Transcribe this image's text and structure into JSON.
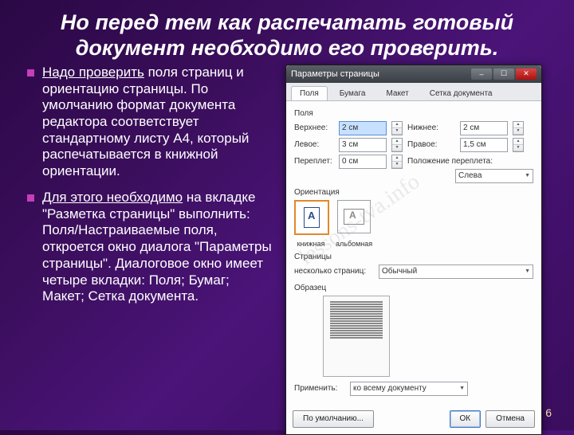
{
  "title": "Но перед тем как распечатать готовый документ необходимо его проверить.",
  "bullets": [
    {
      "lead": "Надо проверить",
      "rest": " поля страниц и ориентацию страницы. По умолчанию формат документа редактора соответствует стандартному листу А4, который распечатывается в книжной ориентации."
    },
    {
      "lead": "Для этого необходимо",
      "rest": " на вкладке \"Разметка страницы\" выполнить: Поля/Настраиваемые поля, откроется окно диалога \"Параметры страницы\". Диалоговое окно имеет четыре вкладки: Поля; Бумаг; Макет; Сетка документа."
    }
  ],
  "dialog": {
    "title": "Параметры страницы",
    "tabs": [
      "Поля",
      "Бумага",
      "Макет",
      "Сетка документа"
    ],
    "fields_section": "Поля",
    "fields": {
      "top_label": "Верхнее:",
      "top_value": "2 см",
      "bottom_label": "Нижнее:",
      "bottom_value": "2 см",
      "left_label": "Левое:",
      "left_value": "3 см",
      "right_label": "Правое:",
      "right_value": "1,5 см",
      "gutter_label": "Переплет:",
      "gutter_value": "0 см",
      "gutter_pos_label": "Положение переплета:",
      "gutter_pos_value": "Слева"
    },
    "orientation_label": "Ориентация",
    "orient": {
      "portrait": "книжная",
      "landscape": "альбомная"
    },
    "pages_label": "Страницы",
    "pages_row_label": "несколько страниц:",
    "pages_value": "Обычный",
    "sample_label": "Образец",
    "apply_label": "Применить:",
    "apply_value": "ко всему документу",
    "btn_default": "По умолчанию...",
    "btn_ok": "ОК",
    "btn_cancel": "Отмена"
  },
  "watermark": "lessons-tva.info",
  "page_number": "6"
}
